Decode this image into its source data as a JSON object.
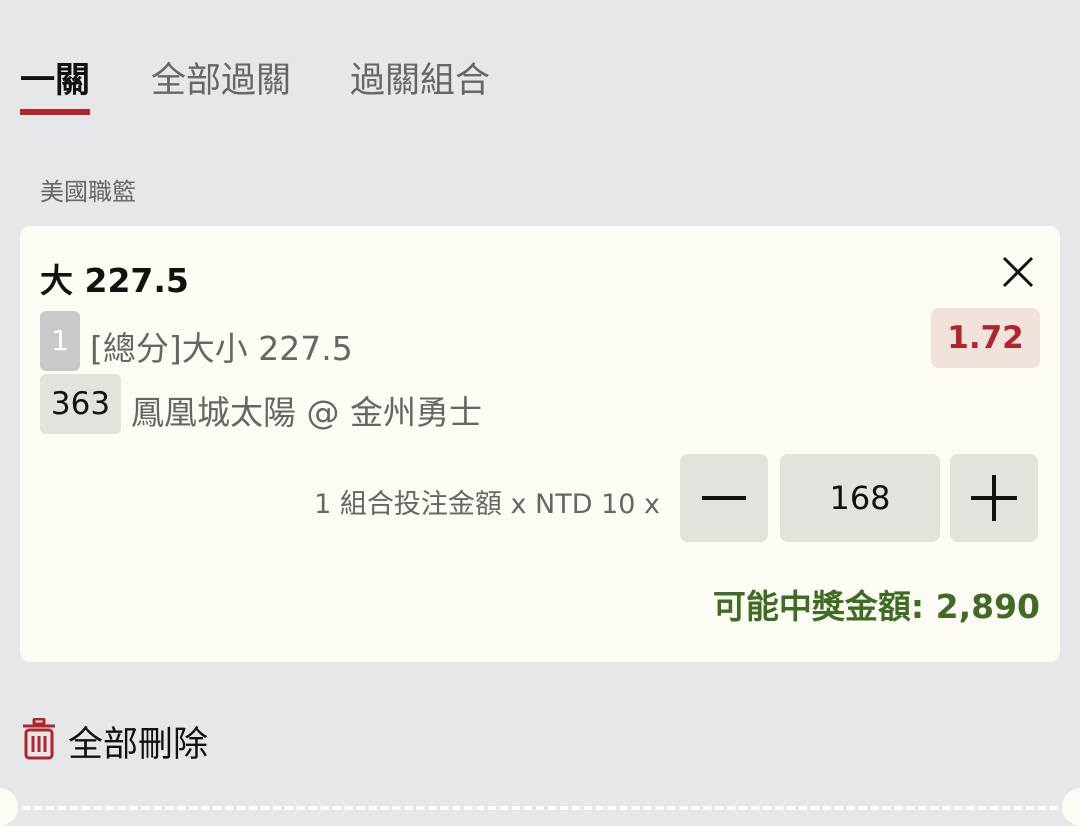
{
  "tabs": [
    {
      "label": "一關",
      "active": true
    },
    {
      "label": "全部過關",
      "active": false
    },
    {
      "label": "過關組合",
      "active": false
    }
  ],
  "league": "美國職籃",
  "bet": {
    "selection": "大 227.5",
    "number": "1",
    "market": "[總分]大小 227.5",
    "odds": "1.72",
    "event_code": "363",
    "event": "鳳凰城太陽 @ 金州勇士",
    "stake_label": "1 組合投注金額 x NTD 10 x",
    "quantity": "168",
    "payout": "可能中獎金額: 2,890"
  },
  "delete_all": "全部刪除",
  "colors": {
    "accent": "#b1262c",
    "payout": "#3f6b23",
    "background": "#e6e7e9",
    "card": "#fdfcf4"
  },
  "icons": [
    "close-icon",
    "minus-icon",
    "plus-icon",
    "trash-icon"
  ]
}
